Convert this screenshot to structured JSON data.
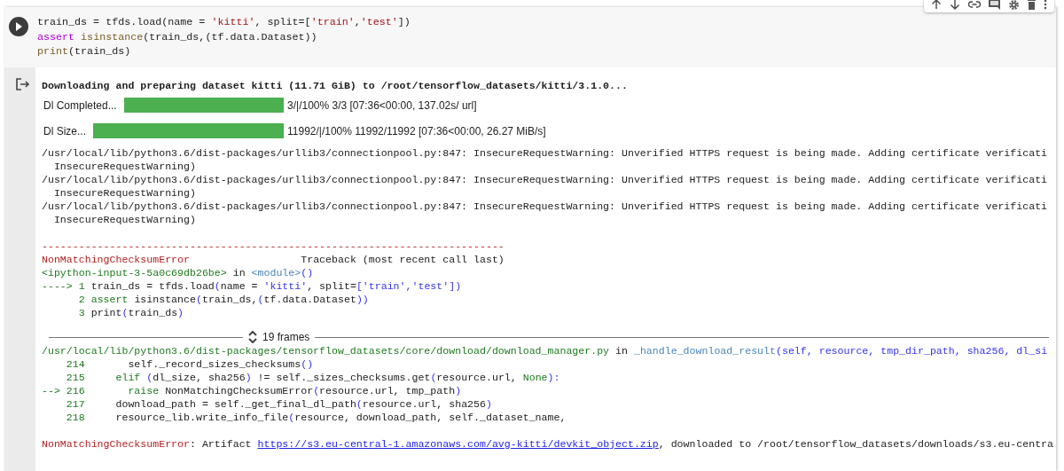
{
  "code_cell": {
    "lines": [
      [
        {
          "text": "train_ds = tfds.load(name = ",
          "kind": "plain"
        },
        {
          "text": "'kitti'",
          "kind": "string"
        },
        {
          "text": ", split=[",
          "kind": "plain"
        },
        {
          "text": "'train'",
          "kind": "string"
        },
        {
          "text": ",",
          "kind": "plain"
        },
        {
          "text": "'test'",
          "kind": "string"
        },
        {
          "text": "])",
          "kind": "plain"
        }
      ],
      [
        {
          "text": "assert",
          "kind": "keyword"
        },
        {
          "text": " isinstance",
          "kind": "builtin"
        },
        {
          "text": "(train_ds,(tf.data.Dataset))",
          "kind": "plain"
        }
      ],
      [
        {
          "text": "print",
          "kind": "builtin"
        },
        {
          "text": "(train_ds)",
          "kind": "plain"
        }
      ]
    ]
  },
  "output": {
    "blocks": [
      {
        "kind": "text",
        "bold": true,
        "lines": [
          [
            {
              "text": "Downloading and preparing dataset kitti (11.71 GiB) to /root/tensorflow_datasets/kitti/3.1.0...",
              "kind": "plain"
            }
          ]
        ]
      },
      {
        "kind": "progress",
        "label": "Dl Completed...",
        "level": 1,
        "status": "3/|/100% 3/3 [07:36<00:00, 137.02s/ url]"
      },
      {
        "kind": "progress",
        "label": "Dl Size...",
        "level": 1,
        "status": "11992/|/100% 11992/11992 [07:36<00:00, 26.27 MiB/s]"
      },
      {
        "kind": "text",
        "bold": false,
        "lines": [
          [
            {
              "text": "/usr/local/lib/python3.6/dist-packages/urllib3/connectionpool.py:847: InsecureRequestWarning: Unverified HTTPS request is being made. Adding certificate verificati",
              "kind": "plain"
            }
          ],
          [
            {
              "text": "  InsecureRequestWarning)",
              "kind": "plain"
            }
          ],
          [
            {
              "text": "/usr/local/lib/python3.6/dist-packages/urllib3/connectionpool.py:847: InsecureRequestWarning: Unverified HTTPS request is being made. Adding certificate verificati",
              "kind": "plain"
            }
          ],
          [
            {
              "text": "  InsecureRequestWarning)",
              "kind": "plain"
            }
          ],
          [
            {
              "text": "/usr/local/lib/python3.6/dist-packages/urllib3/connectionpool.py:847: InsecureRequestWarning: Unverified HTTPS request is being made. Adding certificate verificati",
              "kind": "plain"
            }
          ],
          [
            {
              "text": "  InsecureRequestWarning)",
              "kind": "plain"
            }
          ]
        ]
      },
      {
        "kind": "text",
        "bold": false,
        "lines": [
          [
            {
              "text": "---------------------------------------------------------------------------",
              "kind": "error"
            }
          ],
          [
            {
              "text": "NonMatchingChecksumError",
              "kind": "error"
            },
            {
              "text": "                  Traceback (most recent call last)",
              "kind": "plain"
            }
          ],
          [
            {
              "text": "<ipython-input-3-5a0c69db26be>",
              "kind": "green"
            },
            {
              "text": " in ",
              "kind": "plain"
            },
            {
              "text": "<module>",
              "kind": "func"
            },
            {
              "text": "()",
              "kind": "blue"
            }
          ],
          [
            {
              "text": "----> 1 ",
              "kind": "green"
            },
            {
              "text": "train_ds = tfds.load",
              "kind": "plain"
            },
            {
              "text": "(",
              "kind": "blue"
            },
            {
              "text": "name = ",
              "kind": "plain"
            },
            {
              "text": "'kitti'",
              "kind": "blue"
            },
            {
              "text": ", split=",
              "kind": "plain"
            },
            {
              "text": "['train','test'])",
              "kind": "blue"
            }
          ],
          [
            {
              "text": "      2 ",
              "kind": "green"
            },
            {
              "text": "assert",
              "kind": "green"
            },
            {
              "text": " isinstance",
              "kind": "plain"
            },
            {
              "text": "(",
              "kind": "blue"
            },
            {
              "text": "train_ds,",
              "kind": "plain"
            },
            {
              "text": "(",
              "kind": "blue"
            },
            {
              "text": "tf.data.Dataset",
              "kind": "plain"
            },
            {
              "text": "))",
              "kind": "blue"
            }
          ],
          [
            {
              "text": "      3 ",
              "kind": "green"
            },
            {
              "text": "print",
              "kind": "plain"
            },
            {
              "text": "(",
              "kind": "blue"
            },
            {
              "text": "train_ds",
              "kind": "plain"
            },
            {
              "text": ")",
              "kind": "blue"
            }
          ]
        ]
      },
      {
        "kind": "frames",
        "label": "19 frames"
      },
      {
        "kind": "text",
        "bold": false,
        "lines": [
          [
            {
              "text": "/usr/local/lib/python3.6/dist-packages/tensorflow_datasets/core/download/download_manager.py",
              "kind": "green"
            },
            {
              "text": " in ",
              "kind": "plain"
            },
            {
              "text": "_handle_download_result",
              "kind": "func"
            },
            {
              "text": "(self, resource, tmp_dir_path, sha256, dl_si",
              "kind": "blue"
            }
          ],
          [
            {
              "text": "    214       ",
              "kind": "green"
            },
            {
              "text": "self._record_sizes_checksums",
              "kind": "plain"
            },
            {
              "text": "()",
              "kind": "blue"
            }
          ],
          [
            {
              "text": "    215     ",
              "kind": "green"
            },
            {
              "text": "elif",
              "kind": "green"
            },
            {
              "text": " (",
              "kind": "blue"
            },
            {
              "text": "dl_size, sha256",
              "kind": "plain"
            },
            {
              "text": ")",
              "kind": "blue"
            },
            {
              "text": " != self._sizes_checksums.get",
              "kind": "plain"
            },
            {
              "text": "(",
              "kind": "blue"
            },
            {
              "text": "resource.url, ",
              "kind": "plain"
            },
            {
              "text": "None",
              "kind": "green"
            },
            {
              "text": "):",
              "kind": "blue"
            }
          ],
          [
            {
              "text": "--> 216       ",
              "kind": "green"
            },
            {
              "text": "raise",
              "kind": "green"
            },
            {
              "text": " NonMatchingChecksumError",
              "kind": "plain"
            },
            {
              "text": "(",
              "kind": "blue"
            },
            {
              "text": "resource.url, tmp_path",
              "kind": "plain"
            },
            {
              "text": ")",
              "kind": "blue"
            }
          ],
          [
            {
              "text": "    217     ",
              "kind": "green"
            },
            {
              "text": "download_path = self._get_final_dl_path",
              "kind": "plain"
            },
            {
              "text": "(",
              "kind": "blue"
            },
            {
              "text": "resource.url, sha256",
              "kind": "plain"
            },
            {
              "text": ")",
              "kind": "blue"
            }
          ],
          [
            {
              "text": "    218     ",
              "kind": "green"
            },
            {
              "text": "resource_lib.write_info_file",
              "kind": "plain"
            },
            {
              "text": "(",
              "kind": "blue"
            },
            {
              "text": "resource, download_path, self._dataset_name,",
              "kind": "plain"
            }
          ]
        ]
      },
      {
        "kind": "text",
        "bold": false,
        "lines": [
          [
            {
              "text": "NonMatchingChecksumError",
              "kind": "error"
            },
            {
              "text": ": Artifact ",
              "kind": "plain"
            },
            {
              "text": "https://s3.eu-central-1.amazonaws.com/avg-kitti/devkit_object.zip",
              "kind": "link"
            },
            {
              "text": ", downloaded to /root/tensorflow_datasets/downloads/s3.eu-centra",
              "kind": "plain"
            }
          ]
        ]
      }
    ]
  }
}
